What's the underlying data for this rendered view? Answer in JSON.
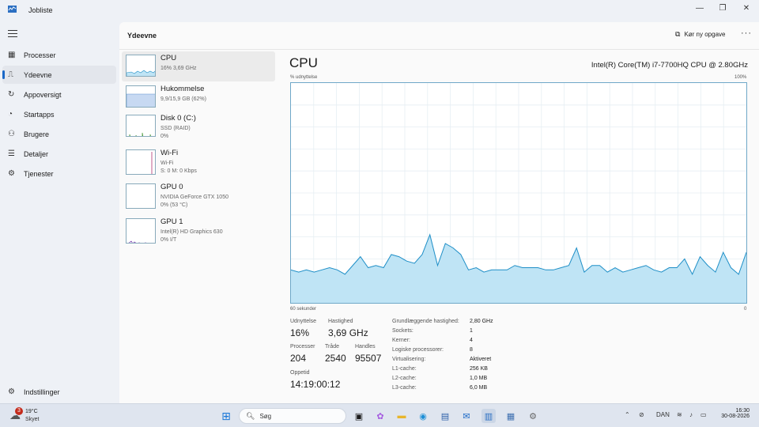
{
  "window": {
    "title": "Jobliste"
  },
  "sidebar": {
    "items": [
      {
        "label": "Processer",
        "icon": "processes-icon",
        "glyph": "▦"
      },
      {
        "label": "Ydeevne",
        "icon": "performance-icon",
        "glyph": "⎍",
        "active": true
      },
      {
        "label": "Appoversigt",
        "icon": "app-history-icon",
        "glyph": "↻"
      },
      {
        "label": "Startapps",
        "icon": "startup-icon",
        "glyph": "◔"
      },
      {
        "label": "Brugere",
        "icon": "users-icon",
        "glyph": "⚇"
      },
      {
        "label": "Detaljer",
        "icon": "details-icon",
        "glyph": "☰"
      },
      {
        "label": "Tjenester",
        "icon": "services-icon",
        "glyph": "⚙"
      }
    ],
    "settings_label": "Indstillinger"
  },
  "header": {
    "title": "Ydeevne",
    "run_task_label": "Kør ny opgave",
    "more": "···"
  },
  "devices": [
    {
      "name": "CPU",
      "sub1": "16% 3,69 GHz",
      "sub2": ""
    },
    {
      "name": "Hukommelse",
      "sub1": "9,9/15,9 GB (62%)",
      "sub2": ""
    },
    {
      "name": "Disk 0 (C:)",
      "sub1": "SSD (RAID)",
      "sub2": "0%"
    },
    {
      "name": "Wi-Fi",
      "sub1": "Wi-Fi",
      "sub2": "S: 0 M: 0 Kbps"
    },
    {
      "name": "GPU 0",
      "sub1": "NVIDIA GeForce GTX 1050",
      "sub2": "0% (53 °C)"
    },
    {
      "name": "GPU 1",
      "sub1": "Intel(R) HD Graphics 630",
      "sub2": "0% I/T"
    }
  ],
  "detail": {
    "title": "CPU",
    "model": "Intel(R) Core(TM) i7-7700HQ CPU @ 2.80GHz",
    "y_label": "% udnyttelse",
    "y_max_label": "100%",
    "x_left_label": "60 sekunder",
    "x_right_label": "0",
    "stats": {
      "utilization_label": "Udnyttelse",
      "utilization": "16%",
      "speed_label": "Hastighed",
      "speed": "3,69 GHz",
      "processes_label": "Processer",
      "processes": "204",
      "threads_label": "Tråde",
      "threads": "2540",
      "handles_label": "Handles",
      "handles": "95507",
      "uptime_label": "Oppetid",
      "uptime": "14:19:00:12"
    },
    "specs": [
      {
        "key": "Grundlæggende hastighed:",
        "value": "2,80 GHz"
      },
      {
        "key": "Sockets:",
        "value": "1"
      },
      {
        "key": "Kerner:",
        "value": "4"
      },
      {
        "key": "Logiske processorer:",
        "value": "8"
      },
      {
        "key": "Virtualisering:",
        "value": "Aktiveret"
      },
      {
        "key": "L1-cache:",
        "value": "256 KB"
      },
      {
        "key": "L2-cache:",
        "value": "1,0 MB"
      },
      {
        "key": "L3-cache:",
        "value": "6,0 MB"
      }
    ]
  },
  "cpu_history": [
    15,
    14,
    15,
    14,
    15,
    16,
    15,
    13,
    17,
    21,
    16,
    17,
    16,
    22,
    21,
    19,
    18,
    22,
    31,
    17,
    27,
    25,
    22,
    15,
    16,
    14,
    15,
    15,
    15,
    17,
    16,
    16,
    16,
    15,
    15,
    16,
    17,
    25,
    14,
    17,
    17,
    14,
    16,
    14,
    15,
    16,
    17,
    15,
    14,
    16,
    16,
    20,
    13,
    21,
    17,
    14,
    23,
    16,
    13,
    23
  ],
  "colors": {
    "graph_line": "#1f8fc7",
    "graph_fill": "#bfe4f5",
    "accent": "#1a68c7"
  },
  "taskbar": {
    "weather_temp": "19°C",
    "weather_desc": "Skyet",
    "weather_badge": "3",
    "search_placeholder": "Søg",
    "language": "DAN",
    "time": "16:30",
    "date": "30-08-2026"
  }
}
